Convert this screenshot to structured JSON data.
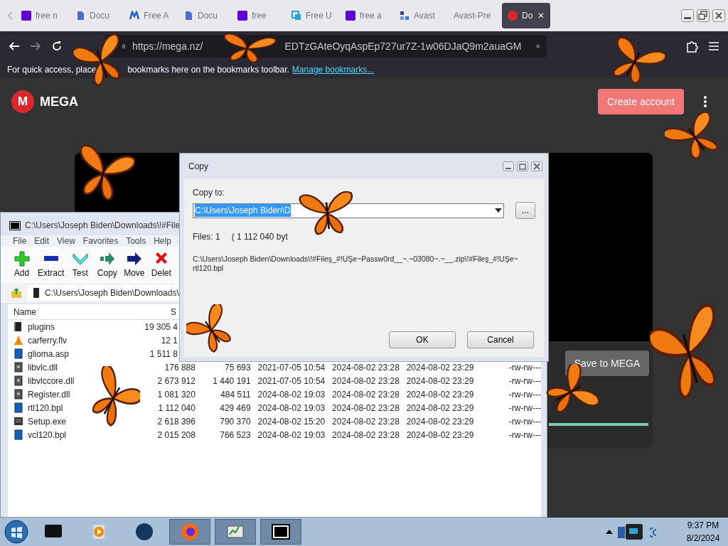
{
  "browser": {
    "tabs": [
      {
        "label": "free n",
        "kind": "purple_square",
        "selected": false
      },
      {
        "label": "Docu",
        "kind": "document",
        "selected": false
      },
      {
        "label": "Free A",
        "kind": "m_logo",
        "selected": false
      },
      {
        "label": "Docu",
        "kind": "document",
        "selected": false
      },
      {
        "label": "free",
        "kind": "purple_square",
        "selected": false
      },
      {
        "label": "Free U",
        "kind": "sync",
        "selected": false
      },
      {
        "label": "free a",
        "kind": "purple_square",
        "selected": false
      },
      {
        "label": "Avast",
        "kind": "squares",
        "selected": false
      },
      {
        "label": "Avast-Pre",
        "kind": "none",
        "selected": false
      },
      {
        "label": "Do",
        "kind": "mega",
        "selected": true
      }
    ],
    "tab_close": "✕",
    "url_start": "https://mega.nz/",
    "url_end": "EDTzGAteOyqAspEp727ur7Z-1w06DJaQ9m2auaGM",
    "bookmarks_start": "For quick access, place",
    "bookmarks_end": "bookmarks here on the bookmarks toolbar.",
    "bookmarks_link": "Manage bookmarks..."
  },
  "mega": {
    "logo_mark": "M",
    "logo_text": "MEGA",
    "create_account": "Create account",
    "save_button": "Save to MEGA",
    "progress": {
      "level": 1.0
    }
  },
  "sevenzip": {
    "title": "C:\\Users\\Joseph Biden\\Downloads\\!#File",
    "menu": [
      "File",
      "Edit",
      "View",
      "Favorites",
      "Tools",
      "Help"
    ],
    "toolbar": [
      {
        "label": "Add",
        "kind": "add"
      },
      {
        "label": "Extract",
        "kind": "extract"
      },
      {
        "label": "Test",
        "kind": "test"
      },
      {
        "label": "Copy",
        "kind": "copy"
      },
      {
        "label": "Move",
        "kind": "move"
      },
      {
        "label": "Delet",
        "kind": "delete"
      }
    ],
    "address": "C:\\Users\\Joseph Biden\\Downloads\\",
    "columns": [
      "Name",
      "S"
    ],
    "rows": [
      {
        "kind": "folder",
        "cells": [
          "plugins",
          "19 305 4"
        ]
      },
      {
        "kind": "cone",
        "cells": [
          "carferry.flv",
          "12 1"
        ]
      },
      {
        "kind": "file",
        "cells": [
          "glioma.asp",
          "1 511 8"
        ]
      },
      {
        "kind": "dll",
        "cells": [
          "libvlc.dll",
          "176 888",
          "75 693",
          "2021-07-05 10:54",
          "2024-08-02 23:28",
          "2024-08-02 23:29",
          "-rw-rw---"
        ]
      },
      {
        "kind": "dll",
        "cells": [
          "libvlccore.dll",
          "2 673 912",
          "1 440 191",
          "2021-07-05 10:54",
          "2024-08-02 23:28",
          "2024-08-02 23:29",
          "-rw-rw---"
        ]
      },
      {
        "kind": "dll",
        "cells": [
          "Register.dll",
          "1 081 320",
          "484 511",
          "2024-08-02 19:03",
          "2024-08-02 23:28",
          "2024-08-02 23:29",
          "-rw-rw---"
        ]
      },
      {
        "kind": "file",
        "cells": [
          "rtl120.bpl",
          "1 112 040",
          "429 469",
          "2024-08-02 19:03",
          "2024-08-02 23:28",
          "2024-08-02 23:29",
          "-rw-rw---"
        ]
      },
      {
        "kind": "exe",
        "cells": [
          "Setup.exe",
          "2 618 396",
          "790 370",
          "2024-08-02 15:20",
          "2024-08-02 23:28",
          "2024-08-02 23:29",
          "-rw-rw---"
        ]
      },
      {
        "kind": "file",
        "cells": [
          "vcl120.bpl",
          "2 015 208",
          "766 523",
          "2024-08-02 19:03",
          "2024-08-02 23:28",
          "2024-08-02 23:29",
          "-rw-rw---"
        ]
      }
    ]
  },
  "copy_dialog": {
    "title": "Copy",
    "label": "Copy to:",
    "value": "C:\\Users\\Joseph Biden\\D",
    "browse": "...",
    "files": "Files: 1",
    "bytes": "( 1 112 040 byt",
    "path_lines": [
      "C:\\Users\\Joseph Biden\\Downloads\\!#Fileş_#!UŞe~Passw0rd__~.~03080~.~__.zip\\!#Fileş_#!UŞe~",
      "rtl120.bpl"
    ],
    "buttons": [
      "OK",
      "Cancel"
    ]
  },
  "taskbar": {
    "time": "9:37 PM",
    "date": "8/2/2024"
  }
}
